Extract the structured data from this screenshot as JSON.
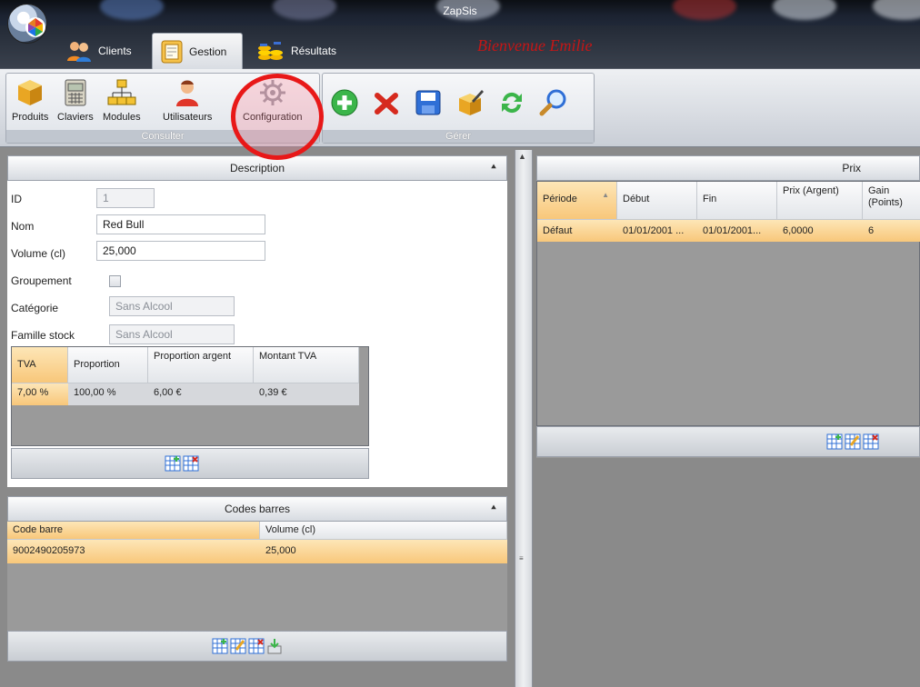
{
  "window": {
    "title": "ZapSis"
  },
  "tabs": [
    {
      "label": "Clients"
    },
    {
      "label": "Gestion"
    },
    {
      "label": "Résultats"
    }
  ],
  "welcome": "Bienvenue Emilie",
  "ribbon": {
    "consulter": {
      "label": "Consulter",
      "buttons": [
        {
          "label": "Produits"
        },
        {
          "label": "Claviers"
        },
        {
          "label": "Modules"
        },
        {
          "label": "Utilisateurs"
        },
        {
          "label": "Configuration"
        }
      ]
    },
    "gerer": {
      "label": "Gérer",
      "buttons": [
        "add-icon",
        "delete-icon",
        "save-icon",
        "edit-box-icon",
        "refresh-icon",
        "search-icon"
      ]
    }
  },
  "description": {
    "title": "Description",
    "fields": {
      "id": {
        "label": "ID",
        "value": "1"
      },
      "nom": {
        "label": "Nom",
        "value": "Red Bull"
      },
      "volume": {
        "label": "Volume (cl)",
        "value": "25,000"
      },
      "groupement": {
        "label": "Groupement"
      },
      "categorie": {
        "label": "Catégorie",
        "value": "Sans Alcool"
      },
      "famille": {
        "label": "Famille stock",
        "value": "Sans Alcool"
      }
    },
    "tva_table": {
      "headers": [
        "TVA",
        "Proportion",
        "Proportion argent",
        "Montant TVA"
      ],
      "rows": [
        [
          "7,00 %",
          "100,00 %",
          "6,00 €",
          "0,39 €"
        ]
      ]
    }
  },
  "barcodes": {
    "title": "Codes barres",
    "headers": [
      "Code barre",
      "Volume (cl)"
    ],
    "rows": [
      [
        "9002490205973",
        "25,000"
      ]
    ]
  },
  "prix": {
    "title": "Prix",
    "headers": [
      "Période",
      "Début",
      "Fin",
      "Prix (Argent)",
      "Gain (Points)"
    ],
    "rows": [
      [
        "Défaut",
        "01/01/2001 ...",
        "01/01/2001...",
        "6,0000",
        "6"
      ]
    ]
  },
  "colors": {
    "welcome": "#c41616",
    "highlight_row": "#f8c77a",
    "annotation_circle": "#e81818"
  }
}
